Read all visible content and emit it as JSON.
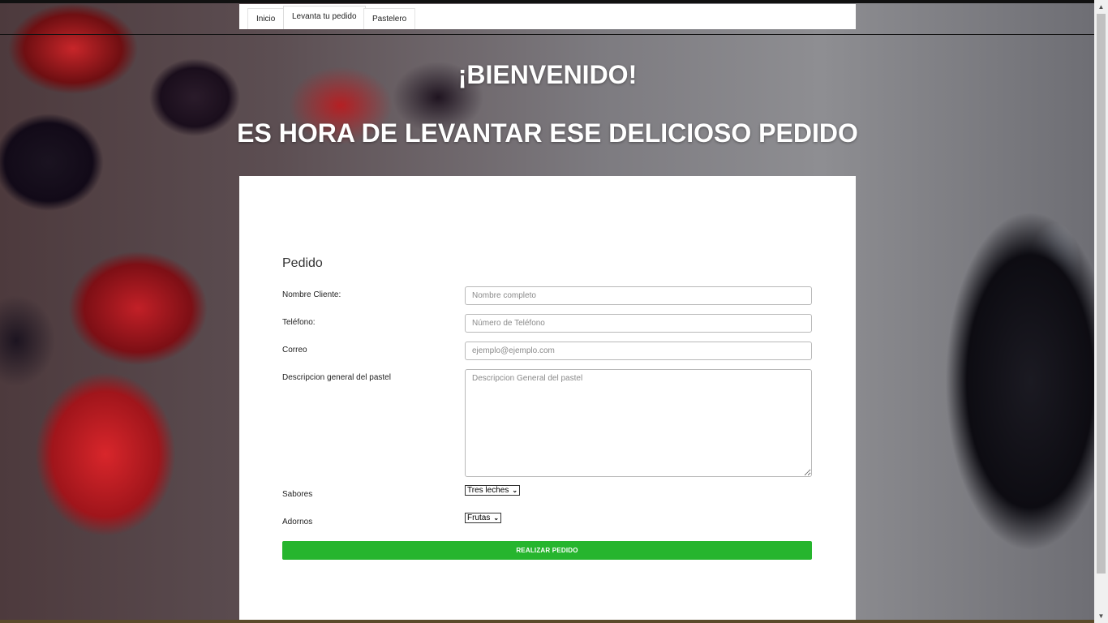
{
  "nav": {
    "tabs": [
      {
        "label": "Inicio"
      },
      {
        "label": "Levanta tu pedido",
        "active": true
      },
      {
        "label": "Pastelero"
      }
    ]
  },
  "hero": {
    "welcome": "¡BIENVENIDO!",
    "subtitle": "ES HORA DE LEVANTAR ESE DELICIOSO PEDIDO"
  },
  "form": {
    "title": "Pedido",
    "name": {
      "label": "Nombre Cliente:",
      "placeholder": "Nombre completo",
      "value": ""
    },
    "phone": {
      "label": "Teléfono:",
      "placeholder": "Número de Teléfono",
      "value": ""
    },
    "email": {
      "label": "Correo",
      "placeholder": "ejemplo@ejemplo.com",
      "value": ""
    },
    "description": {
      "label": "Descripcion general del pastel",
      "placeholder": "Descripcion General del pastel",
      "value": ""
    },
    "flavors": {
      "label": "Sabores",
      "selected": "Tres leches"
    },
    "decorations": {
      "label": "Adornos",
      "selected": "Frutas"
    },
    "submit_label": "REALIZAR PEDIDO"
  },
  "colors": {
    "submit": "#26b52e",
    "panel": "#ffffff"
  },
  "icons": {
    "select_arrow": "chevron-down-icon",
    "scroll_up": "caret-up-icon",
    "scroll_down": "caret-down-icon"
  }
}
